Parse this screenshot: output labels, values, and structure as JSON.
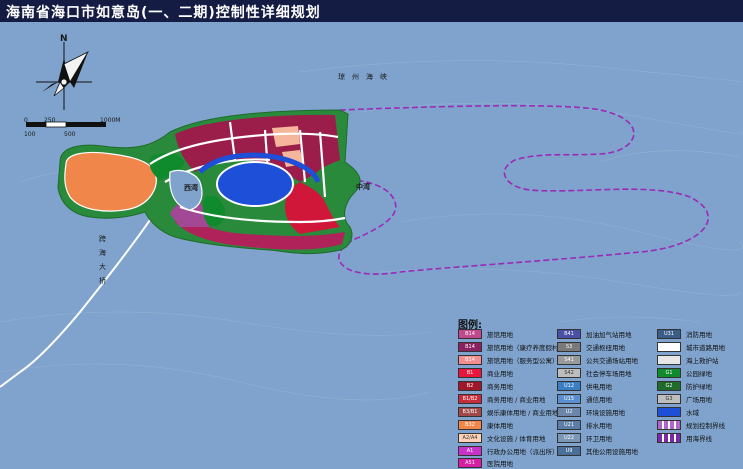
{
  "title": "海南省海口市如意岛(一、二期)控制性详细规划",
  "compass": {
    "north_label": "N"
  },
  "scale": {
    "labels": [
      "0",
      "250",
      "100",
      "500",
      "1000M"
    ]
  },
  "places": {
    "strait": "琼　州　海　峡",
    "west_bay": "西湾",
    "middle_bay": "中湾",
    "bridge": "跨海大桥"
  },
  "legend": {
    "title": "图例:",
    "items": [
      {
        "code": "B14",
        "label": "旅馆用地",
        "color": "#c14a8e"
      },
      {
        "code": "B14",
        "label": "旅馆用地（康疗养度假村）",
        "color": "#8b2160"
      },
      {
        "code": "B14",
        "label": "旅馆用地（服务型公寓）",
        "color": "#f28e8e"
      },
      {
        "code": "B1",
        "label": "商业用地",
        "color": "#e8153c"
      },
      {
        "code": "B2",
        "label": "商务用地",
        "color": "#a0172c"
      },
      {
        "code": "B1/B2",
        "label": "商务用地 / 商业用地",
        "color": "#c72c3a"
      },
      {
        "code": "B3/B1",
        "label": "娱乐康体用地 / 商业用地",
        "color": "#a34848"
      },
      {
        "code": "B32",
        "label": "康体用地",
        "color": "#f0864a"
      },
      {
        "code": "A2/A4",
        "label": "文化设施 / 体育用地",
        "color": "#ffd2b8"
      },
      {
        "code": "A1",
        "label": "行政办公用地（派出所）",
        "color": "#c832c8"
      },
      {
        "code": "A51",
        "label": "医院用地",
        "color": "#d81ea5"
      },
      {
        "code": "B41",
        "label": "加油加气站用地",
        "color": "#4a4fa8"
      },
      {
        "code": "S3",
        "label": "交通枢纽用地",
        "color": "#7a7a7a"
      },
      {
        "code": "S41",
        "label": "公共交通场站用地",
        "color": "#9a9a9a"
      },
      {
        "code": "S42",
        "label": "社会停车场用地",
        "color": "#bdbdbd"
      },
      {
        "code": "U12",
        "label": "供电用地",
        "color": "#3a7fc4"
      },
      {
        "code": "U15",
        "label": "通信用地",
        "color": "#5b8fd0"
      },
      {
        "code": "U2",
        "label": "环境设施用地",
        "color": "#6b86a8"
      },
      {
        "code": "U21",
        "label": "排水用地",
        "color": "#5a7ea8"
      },
      {
        "code": "U22",
        "label": "环卫用地",
        "color": "#7a97b8"
      },
      {
        "code": "U9",
        "label": "其他公用设施用地",
        "color": "#4a6f9a"
      },
      {
        "code": "U31",
        "label": "消防用地",
        "color": "#3b5e88"
      },
      {
        "code": "",
        "label": "城市道路用地",
        "color": "#ffffff"
      },
      {
        "code": "",
        "label": "海上救护站",
        "color": "#e6e6e6"
      },
      {
        "code": "G1",
        "label": "公园绿地",
        "color": "#0f8a2c"
      },
      {
        "code": "G2",
        "label": "防护绿地",
        "color": "#1f6b2a"
      },
      {
        "code": "G3",
        "label": "广场用地",
        "color": "#bdbdbd"
      },
      {
        "code": "",
        "label": "水域",
        "color": "#1d4fd8"
      },
      {
        "code": "",
        "label": "规划控制界线",
        "color": "#b066c8"
      },
      {
        "code": "",
        "label": "用海界线",
        "color": "#7a2aa8"
      }
    ]
  }
}
